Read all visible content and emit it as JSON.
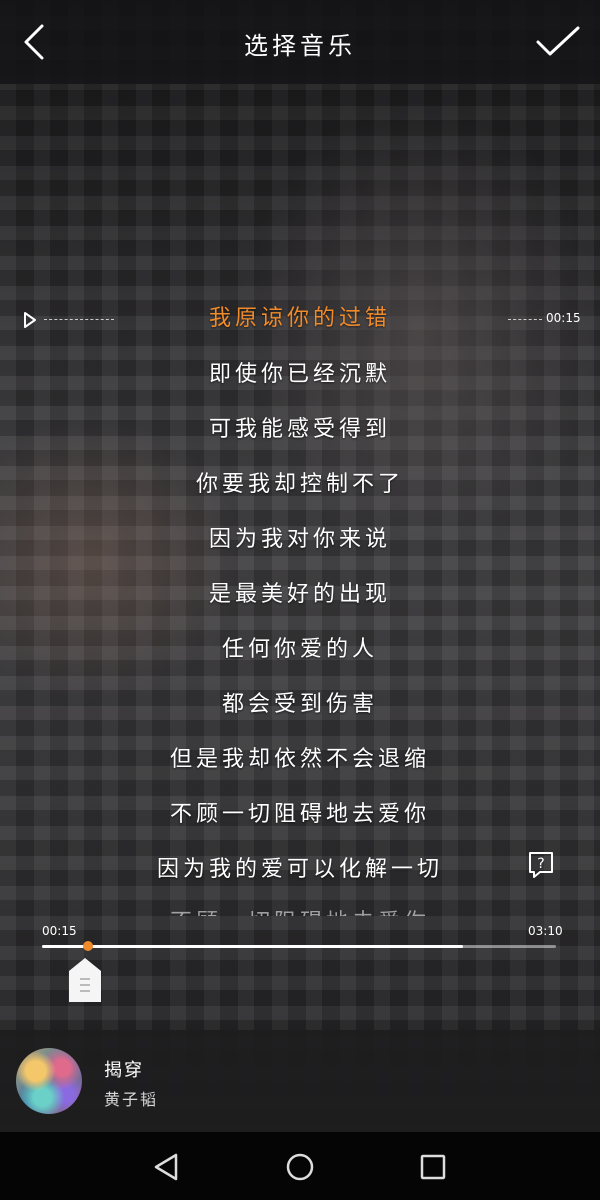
{
  "header": {
    "title": "选择音乐",
    "back_icon": "chevron-left-icon",
    "confirm_icon": "checkmark-icon"
  },
  "lyric_indicator": {
    "time": "00:15",
    "play_icon": "play-outline-icon"
  },
  "lyrics": {
    "active_index": 0,
    "lines": [
      "我原谅你的过错",
      "即使你已经沉默",
      "可我能感受得到",
      "你要我却控制不了",
      "因为我对你来说",
      "是最美好的出现",
      "任何你爱的人",
      "都会受到伤害",
      "但是我却依然不会退缩",
      "不顾一切阻碍地去爱你",
      "因为我的爱可以化解一切",
      "不顾一切阻碍地去爱你"
    ]
  },
  "progress": {
    "start_time": "00:15",
    "end_time": "03:10",
    "played_fraction": 0.09,
    "buffered_fraction": 0.82,
    "accent": "#f08a2a"
  },
  "song": {
    "title": "揭穿",
    "artist": "黄子韬"
  },
  "nav": {
    "back_icon": "triangle-back-icon",
    "home_icon": "circle-home-icon",
    "recents_icon": "square-recents-icon"
  }
}
